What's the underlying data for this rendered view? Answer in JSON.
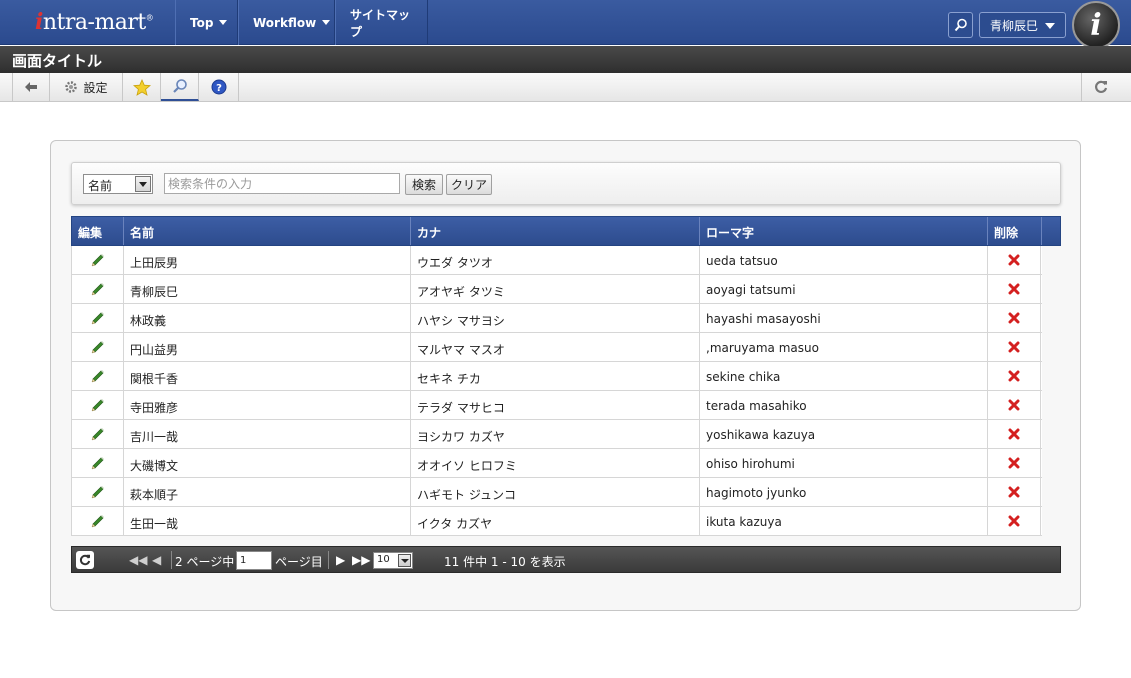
{
  "header": {
    "logo_prefix": "i",
    "logo_rest": "ntra-mart",
    "logo_mark": "®",
    "nav": [
      {
        "label": "Top",
        "has_caret": true
      },
      {
        "label": "Workflow",
        "has_caret": true
      },
      {
        "label": "サイトマップ",
        "has_caret": false
      }
    ],
    "user_name": "青柳辰巳",
    "badge_letter": "i"
  },
  "page_title": "画面タイトル",
  "toolbar": {
    "settings_label": "設定"
  },
  "search": {
    "field_selected": "名前",
    "placeholder": "検索条件の入力",
    "search_button": "検索",
    "clear_button": "クリア"
  },
  "grid": {
    "columns": [
      "編集",
      "名前",
      "カナ",
      "ローマ字",
      "削除"
    ],
    "rows": [
      {
        "name": "上田辰男",
        "kana": "ウエダ タツオ",
        "romaji": "ueda tatsuo"
      },
      {
        "name": "青柳辰巳",
        "kana": "アオヤギ タツミ",
        "romaji": "aoyagi tatsumi"
      },
      {
        "name": "林政義",
        "kana": "ハヤシ マサヨシ",
        "romaji": "hayashi masayoshi"
      },
      {
        "name": "円山益男",
        "kana": "マルヤマ マスオ",
        "romaji": ",maruyama masuo"
      },
      {
        "name": "関根千香",
        "kana": "セキネ チカ",
        "romaji": "sekine chika"
      },
      {
        "name": "寺田雅彦",
        "kana": "テラダ マサヒコ",
        "romaji": "terada masahiko"
      },
      {
        "name": "吉川一哉",
        "kana": "ヨシカワ カズヤ",
        "romaji": "yoshikawa kazuya"
      },
      {
        "name": "大磯博文",
        "kana": "オオイソ ヒロフミ",
        "romaji": "ohiso hirohumi"
      },
      {
        "name": "萩本順子",
        "kana": "ハギモト ジュンコ",
        "romaji": "hagimoto jyunko"
      },
      {
        "name": "生田一哉",
        "kana": "イクタ カズヤ",
        "romaji": "ikuta kazuya"
      }
    ]
  },
  "pager": {
    "total_pages_text": "2 ページ中",
    "current_page": "1",
    "page_suffix": "ページ目",
    "page_size": "10",
    "summary": "11 件中 1 - 10 を表示"
  },
  "colors": {
    "header_blue": "#2b4a8e",
    "edit_green": "#3a8a2a",
    "delete_red": "#d42020"
  }
}
